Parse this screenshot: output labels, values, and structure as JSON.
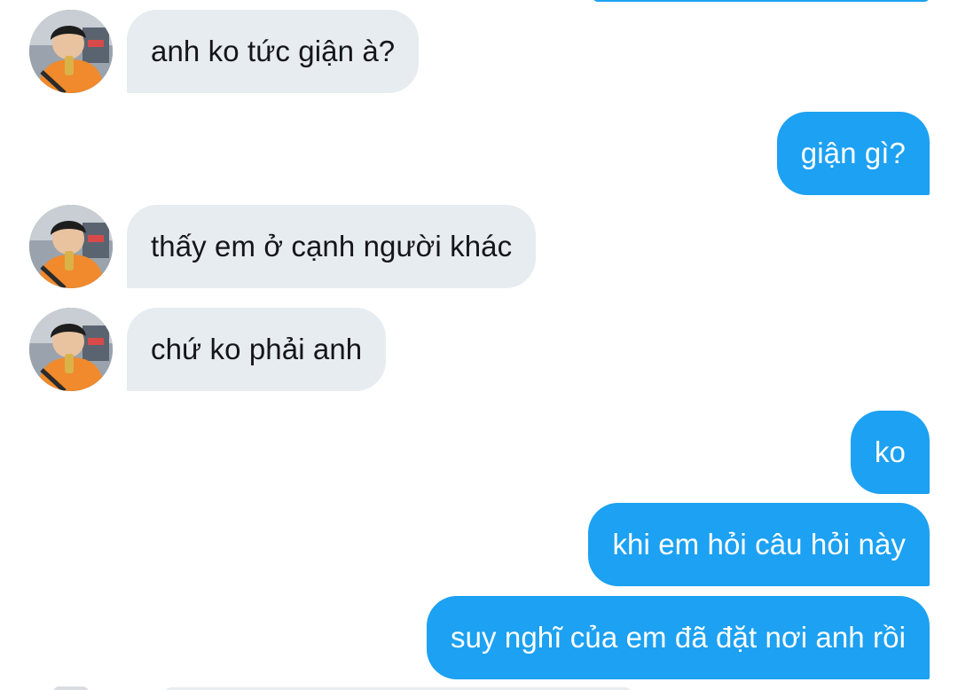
{
  "colors": {
    "incoming_bubble": "#e6ecf0",
    "outgoing_bubble": "#1da1f2",
    "incoming_text": "#14171a",
    "outgoing_text": "#ffffff"
  },
  "conversation": {
    "messages": [
      {
        "direction": "incoming",
        "text": "anh ko tức giận à?",
        "avatar": "user-avatar"
      },
      {
        "direction": "outgoing",
        "text": "giận gì?"
      },
      {
        "direction": "incoming",
        "text": "thấy em ở cạnh người khác",
        "avatar": "user-avatar"
      },
      {
        "direction": "incoming",
        "text": "chứ ko phải anh",
        "avatar": "user-avatar"
      },
      {
        "direction": "outgoing",
        "text": "ko"
      },
      {
        "direction": "outgoing",
        "text": "khi em hỏi câu hỏi này"
      },
      {
        "direction": "outgoing",
        "text": "suy nghĩ của em đã đặt nơi anh rồi"
      }
    ]
  }
}
